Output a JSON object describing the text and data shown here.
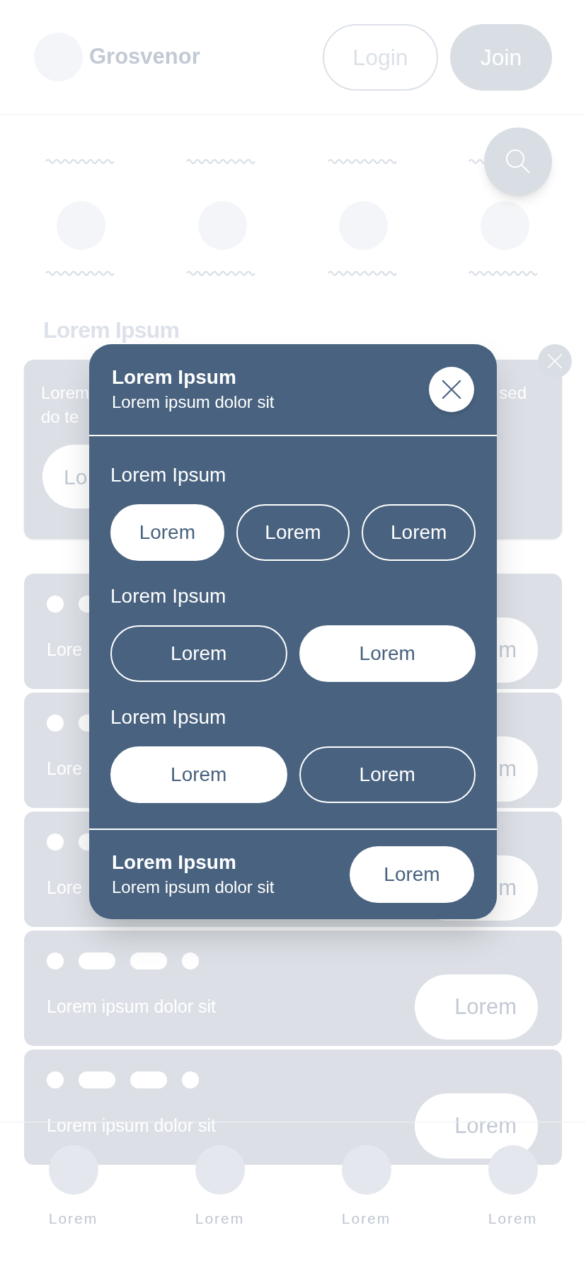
{
  "header": {
    "brand": "Grosvenor",
    "login": "Login",
    "join": "Join"
  },
  "section_title": "Lorem Ipsum",
  "promo": {
    "text_left": [
      "Lorem",
      "do te"
    ],
    "text_right": "sed",
    "button": "Lo"
  },
  "list_rows": [
    {
      "kind": "covered",
      "text": "Lore",
      "button": "m"
    },
    {
      "kind": "covered",
      "text": "Lore",
      "button": "m"
    },
    {
      "kind": "covered",
      "text": "Lore",
      "button": "m"
    },
    {
      "kind": "full",
      "text": "Lorem ipsum dolor sit",
      "button": "Lorem"
    },
    {
      "kind": "full",
      "text": "Lorem ipsum dolor sit",
      "button": "Lorem"
    }
  ],
  "bottom_nav": [
    {
      "label": "Lorem"
    },
    {
      "label": "Lorem"
    },
    {
      "label": "Lorem"
    },
    {
      "label": "Lorem"
    }
  ],
  "modal": {
    "title": "Lorem Ipsum",
    "subtitle": "Lorem ipsum dolor sit",
    "groups": [
      {
        "label": "Lorem Ipsum",
        "options": [
          {
            "label": "Lorem",
            "selected": true
          },
          {
            "label": "Lorem",
            "selected": false
          },
          {
            "label": "Lorem",
            "selected": false
          }
        ]
      },
      {
        "label": "Lorem Ipsum",
        "options": [
          {
            "label": "Lorem",
            "selected": false
          },
          {
            "label": "Lorem",
            "selected": true
          }
        ]
      },
      {
        "label": "Lorem Ipsum",
        "options": [
          {
            "label": "Lorem",
            "selected": true
          },
          {
            "label": "Lorem",
            "selected": false
          }
        ]
      }
    ],
    "footer": {
      "title": "Lorem Ipsum",
      "subtitle": "Lorem ipsum dolor sit",
      "button": "Lorem"
    }
  }
}
